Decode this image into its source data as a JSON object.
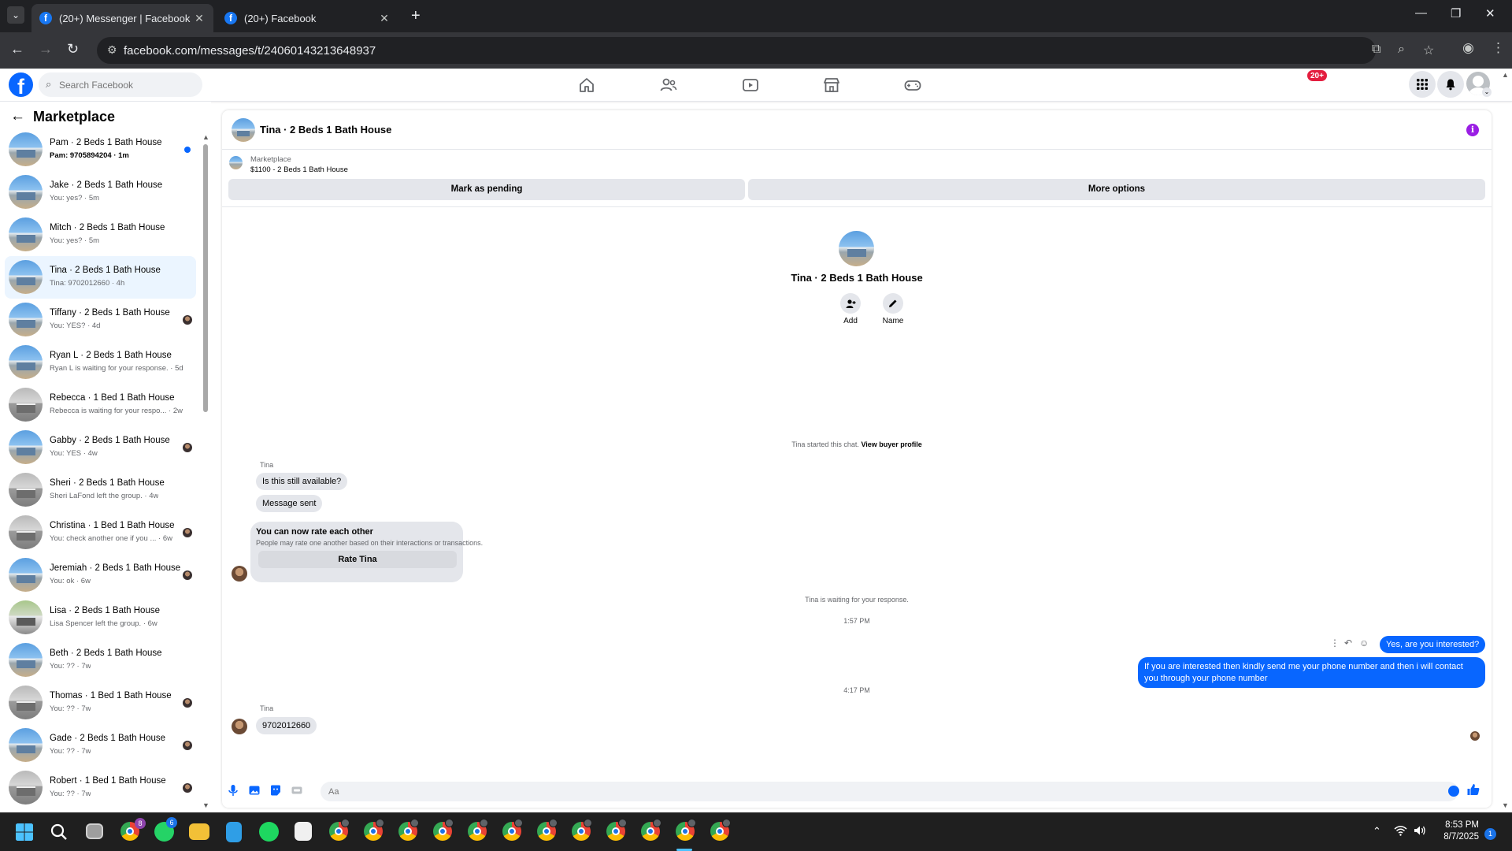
{
  "browser": {
    "tabs": [
      {
        "title": "(20+) Messenger | Facebook",
        "active": true
      },
      {
        "title": "(20+) Facebook",
        "active": false
      }
    ],
    "url": "facebook.com/messages/t/24060143213648937"
  },
  "fb_header": {
    "search_placeholder": "Search Facebook",
    "notification_badge": "20+",
    "nav_icons": [
      "home-icon",
      "friends-icon",
      "video-icon",
      "marketplace-icon",
      "gaming-icon"
    ]
  },
  "sidebar": {
    "title": "Marketplace",
    "conversations": [
      {
        "name": "Pam · 2 Beds 1 Bath House",
        "snippet": "Pam: 9705894204 · 1m",
        "unread": true,
        "indicator": "dot",
        "thumb": "blue"
      },
      {
        "name": "Jake · 2 Beds 1 Bath House",
        "snippet": "You: yes? · 5m",
        "indicator": "",
        "thumb": "blue"
      },
      {
        "name": "Mitch · 2 Beds 1 Bath House",
        "snippet": "You: yes? · 5m",
        "indicator": "",
        "thumb": "blue"
      },
      {
        "name": "Tina · 2 Beds 1 Bath House",
        "snippet": "Tina: 9702012660 · 4h",
        "active": true,
        "indicator": "",
        "thumb": "blue"
      },
      {
        "name": "Tiffany · 2 Beds 1 Bath House",
        "snippet": "You: YES? · 4d",
        "indicator": "face",
        "thumb": "blue"
      },
      {
        "name": "Ryan L · 2 Beds 1 Bath House",
        "snippet": "Ryan L is waiting for your response. · 5d",
        "indicator": "",
        "thumb": "blue"
      },
      {
        "name": "Rebecca · 1 Bed 1 Bath House",
        "snippet": "Rebecca is waiting for your respo... · 2w",
        "indicator": "",
        "thumb": "gray"
      },
      {
        "name": "Gabby · 2 Beds 1 Bath House",
        "snippet": "You: YES · 4w",
        "indicator": "face",
        "thumb": "blue"
      },
      {
        "name": "Sheri · 2 Beds 1 Bath House",
        "snippet": "Sheri LaFond left the group. · 4w",
        "indicator": "",
        "thumb": "gray"
      },
      {
        "name": "Christina · 1 Bed 1 Bath House",
        "snippet": "You: check another one if you ... · 6w",
        "indicator": "face",
        "thumb": "gray"
      },
      {
        "name": "Jeremiah · 2 Beds 1 Bath House",
        "snippet": "You: ok · 6w",
        "indicator": "face",
        "thumb": "blue"
      },
      {
        "name": "Lisa · 2 Beds 1 Bath House",
        "snippet": "Lisa Spencer left the group. · 6w",
        "indicator": "",
        "thumb": "green"
      },
      {
        "name": "Beth · 2 Beds 1 Bath House",
        "snippet": "You: ?? · 7w",
        "indicator": "",
        "thumb": "blue"
      },
      {
        "name": "Thomas · 1 Bed 1 Bath House",
        "snippet": "You: ?? · 7w",
        "indicator": "face",
        "thumb": "gray"
      },
      {
        "name": "Gade · 2 Beds 1 Bath House",
        "snippet": "You: ?? · 7w",
        "indicator": "face",
        "thumb": "blue"
      },
      {
        "name": "Robert · 1 Bed 1 Bath House",
        "snippet": "You: ?? · 7w",
        "indicator": "face",
        "thumb": "gray"
      }
    ]
  },
  "chat": {
    "title": "Tina · 2 Beds 1 Bath House",
    "marketplace_label": "Marketplace",
    "listing": "$1100 - 2 Beds 1 Bath House",
    "mark_pending": "Mark as pending",
    "more_options": "More options",
    "intro_name": "Tina · 2 Beds 1 Bath House",
    "add_label": "Add",
    "name_label": "Name",
    "started_text": "Tina started this chat.",
    "view_profile": "View buyer profile",
    "sender": "Tina",
    "msg1": "Is this still available?",
    "msg2": "Message sent",
    "rate_title": "You can now rate each other",
    "rate_sub": "People may rate one another based on their interactions or transactions.",
    "rate_button": "Rate Tina",
    "waiting": "Tina is waiting for your response.",
    "time1": "1:57 PM",
    "out1": "Yes, are you interested?",
    "out2_line1": "If you are interested then kindly send me your phone number and then i will contact",
    "out2_line2": "you through your phone number",
    "time2": "4:17 PM",
    "sender2": "Tina",
    "msg3": "9702012660",
    "composer_placeholder": "Aa"
  },
  "taskbar": {
    "time": "8:53 PM",
    "date": "8/7/2025",
    "notification_count": "1",
    "badges": {
      "chrome_first": "8",
      "whatsapp": "6"
    }
  }
}
